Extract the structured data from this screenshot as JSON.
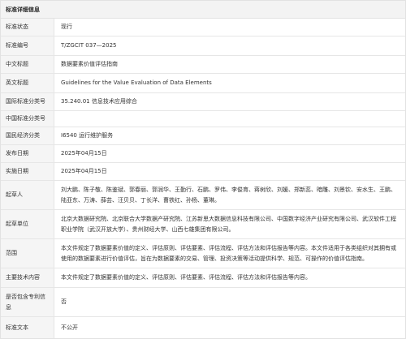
{
  "panel": {
    "title": "标准详细信息"
  },
  "rows": [
    {
      "label": "标准状态",
      "value": "现行"
    },
    {
      "label": "标准编号",
      "value": "T/ZGCIT 037—2025"
    },
    {
      "label": "中文标题",
      "value": "数据要素价值评估指南"
    },
    {
      "label": "英文标题",
      "value": "Guidelines for the Value Evaluation of Data Elements"
    },
    {
      "label": "国际标准分类号",
      "value": "35.240.01 信息技术应用综合"
    },
    {
      "label": "中国标准分类号",
      "value": ""
    },
    {
      "label": "国民经济分类",
      "value": "I6540 运行维护服务"
    },
    {
      "label": "发布日期",
      "value": "2025年04月15日"
    },
    {
      "label": "实施日期",
      "value": "2025年04月15日"
    },
    {
      "label": "起草人",
      "value": "刘大鹏、陈子敬、陈鉴斌、郭春丽、郭润华、王勤行、石鹏、罗伟、李俊育、蒋树欣、刘媛、郑新蕊、暗雕、刘景钦、安水生、王鹏、陆亚东、万涛、薛芸、汪贝贝、丁长洋、曹铁红、孙杨、董琳。"
    },
    {
      "label": "起草单位",
      "value": "北京大数据研究院、北京联合大学数据产研究院、江苏新思大数据信息科技有限公司、中国数字经济产业研究有限公司、武汉软件工程职业学院（武汉开放大学）、贵州财经大学、山西七雄集团有限公司。"
    },
    {
      "label": "范围",
      "value": "本文件规定了数据要素价值的定义、评估原则、评估要素、评估流程、评估方法和评估报告等内容。本文件适用于各类组织对其拥有或使用的数据要素进行价值评估，旨在为数据要素的交易、管理、投资决策等活动提供科学、规范、可操作的价值评估指南。"
    },
    {
      "label": "主要技术内容",
      "value": "本文件规定了数据要素价值的定义、评估原则、评估要素、评估流程、评估方法和评估报告等内容。"
    },
    {
      "label": "是否包含专利信息",
      "value": "否"
    },
    {
      "label": "标准文本",
      "value": "不公开"
    }
  ]
}
